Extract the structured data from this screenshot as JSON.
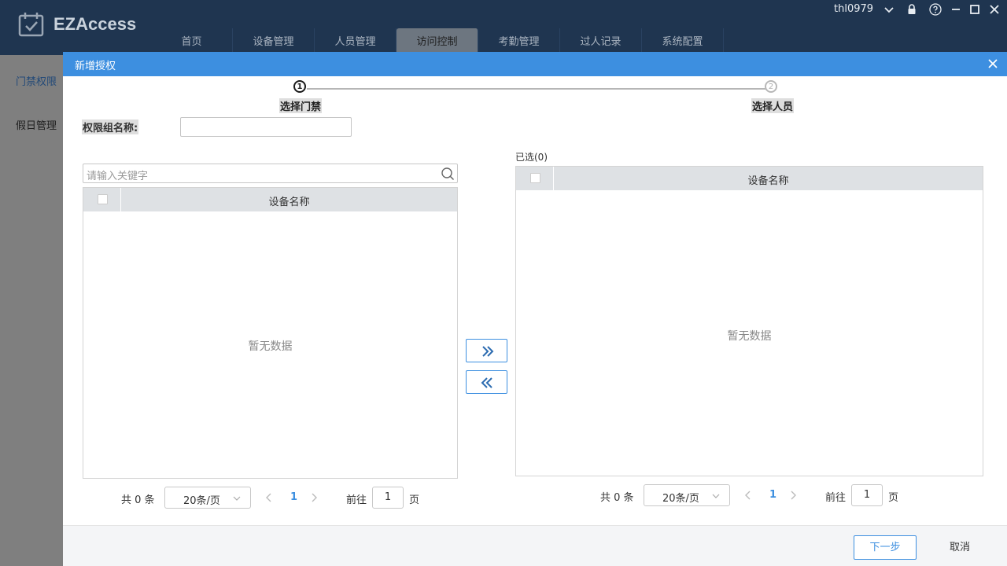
{
  "app": {
    "name": "EZAccess"
  },
  "nav": {
    "items": [
      {
        "label": "首页"
      },
      {
        "label": "设备管理"
      },
      {
        "label": "人员管理"
      },
      {
        "label": "访问控制",
        "active": true
      },
      {
        "label": "考勤管理"
      },
      {
        "label": "过人记录"
      },
      {
        "label": "系统配置"
      }
    ]
  },
  "user": {
    "name": "thl0979"
  },
  "sidebar": {
    "items": [
      {
        "label": "门禁权限",
        "active": true
      },
      {
        "label": "假日管理"
      }
    ]
  },
  "dialog": {
    "title": "新增授权",
    "steps": [
      {
        "number": "1",
        "label": "选择门禁",
        "active": true
      },
      {
        "number": "2",
        "label": "选择人员",
        "active": false
      }
    ],
    "group_name": {
      "label": "权限组名称:",
      "value": ""
    },
    "left": {
      "search_placeholder": "请输入关键字",
      "column": "设备名称",
      "empty": "暂无数据",
      "pager": {
        "total": "共 0 条",
        "page_size": "20条/页",
        "current": "1",
        "goto_label": "前往",
        "goto_value": "1",
        "goto_unit": "页"
      }
    },
    "right": {
      "selected_label": "已选(0)",
      "column": "设备名称",
      "empty": "暂无数据",
      "pager": {
        "total": "共 0 条",
        "page_size": "20条/页",
        "current": "1",
        "goto_label": "前往",
        "goto_value": "1",
        "goto_unit": "页"
      }
    },
    "buttons": {
      "next": "下一步",
      "cancel": "取消"
    }
  },
  "colors": {
    "accent": "#3d8fe0",
    "topbar": "#1f3550",
    "header_row": "#dee1e4"
  }
}
